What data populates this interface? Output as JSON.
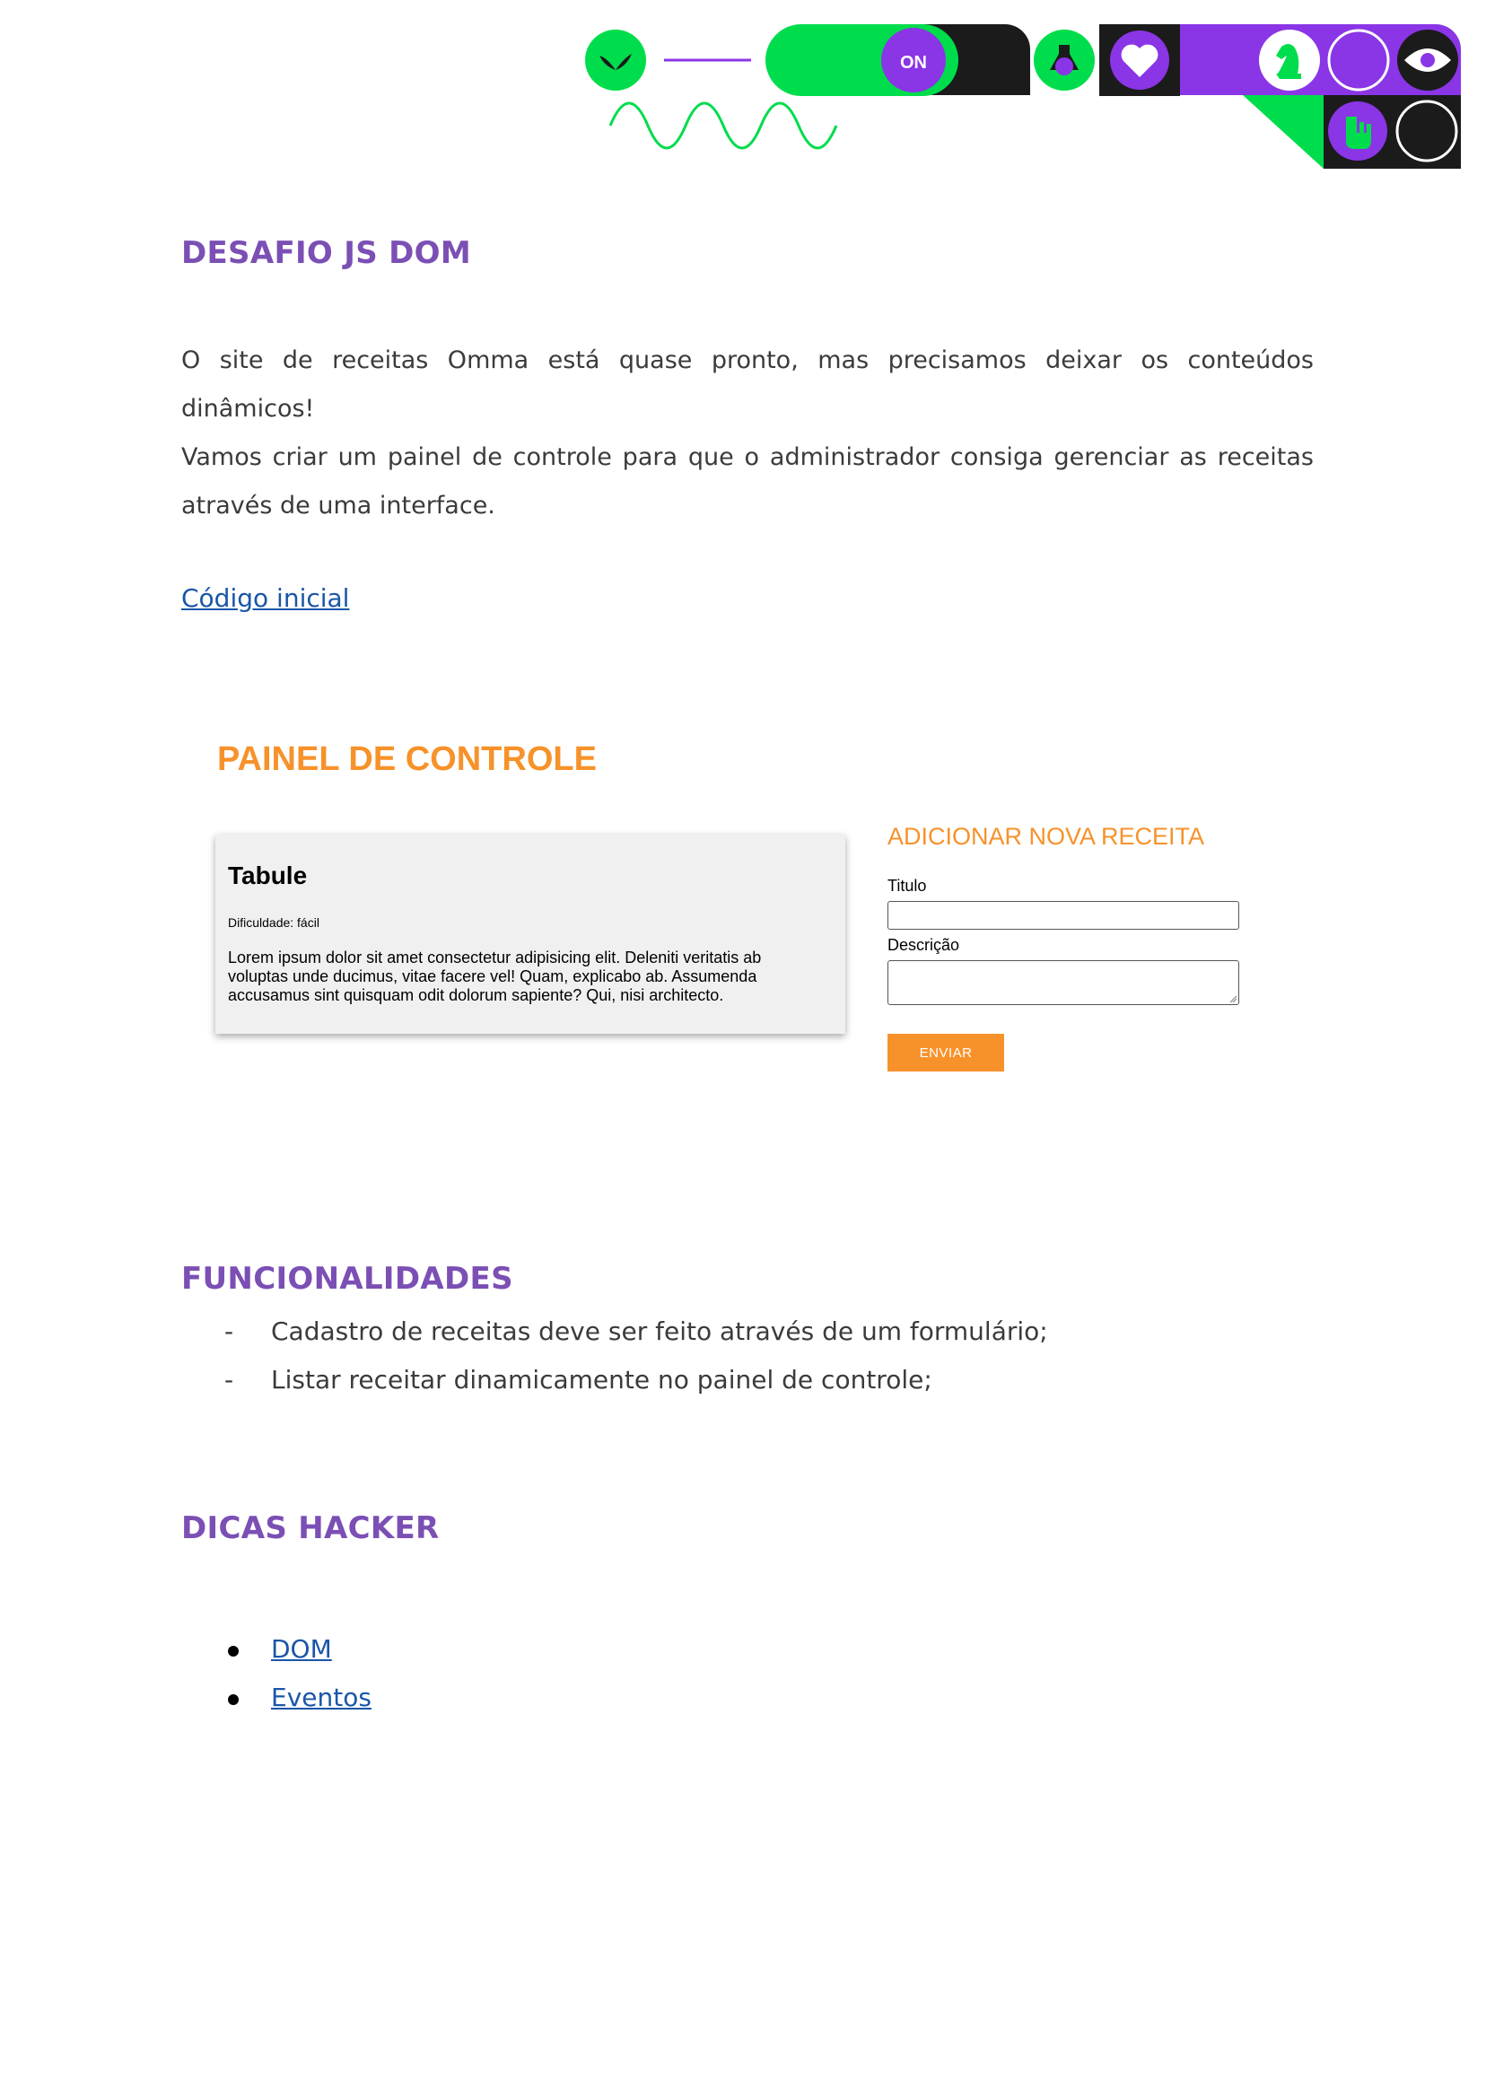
{
  "colors": {
    "heading": "#7b4fb4",
    "link": "#1a56a8",
    "panel_orange": "#f7922a",
    "banner_green": "#00dd4c",
    "banner_purple": "#8a35e6",
    "banner_black": "#1b1b1b"
  },
  "banner": {
    "toggle_label": "ON",
    "icons": [
      "leaf-icon",
      "flask-icon",
      "heart-icon",
      "chess-knight-icon",
      "circle-outline-icon",
      "eye-icon",
      "rock-hand-icon"
    ]
  },
  "main": {
    "heading": "DESAFIO JS DOM",
    "intro_line1": "O site de receitas Omma está quase pronto, mas precisamos deixar os conteúdos dinâmicos!",
    "intro_line2": "Vamos criar um painel de controle para que o administrador consiga gerenciar as receitas através de uma interface.",
    "starter_link": "Código inicial"
  },
  "screenshot": {
    "panel_title": "PAINEL DE CONTROLE",
    "recipe": {
      "title": "Tabule",
      "difficulty": "Dificuldade: fácil",
      "description": "Lorem ipsum dolor sit amet consectetur adipisicing elit. Deleniti veritatis ab voluptas unde ducimus, vitae facere vel! Quam, explicabo ab. Assumenda accusamus sint quisquam odit dolorum sapiente? Qui, nisi architecto."
    },
    "form": {
      "title": "ADICIONAR NOVA RECEITA",
      "title_label": "Titulo",
      "description_label": "Descrição",
      "submit_label": "ENVIAR"
    }
  },
  "features": {
    "heading": "FUNCIONALIDADES",
    "items": [
      "Cadastro de receitas deve ser feito através de um formulário;",
      "Listar receitar dinamicamente no painel de controle;"
    ]
  },
  "tips": {
    "heading": "DICAS HACKER",
    "links": [
      "DOM",
      "Eventos"
    ]
  }
}
